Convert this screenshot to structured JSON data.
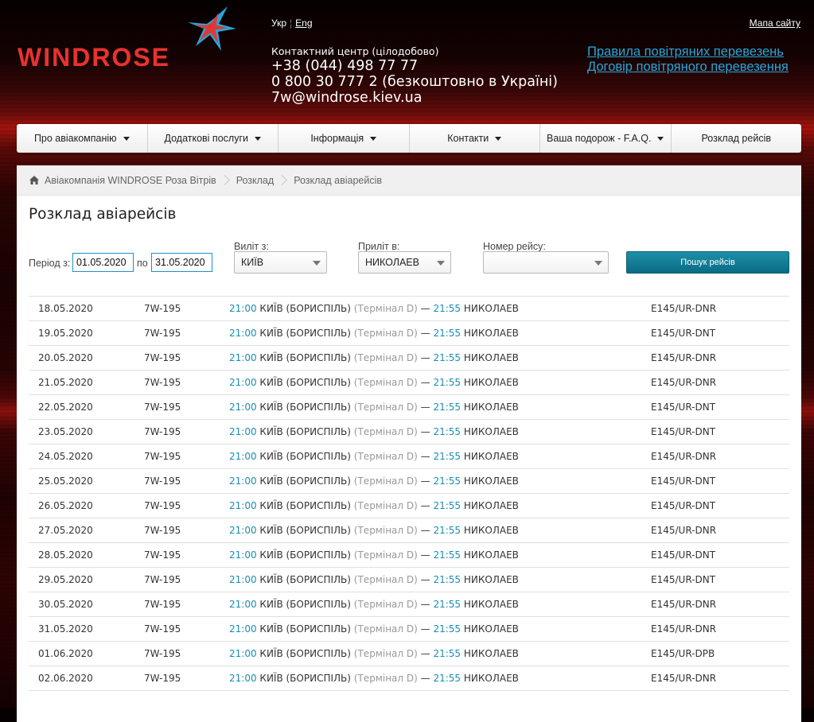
{
  "header": {
    "logo_text": "WINDROSE",
    "lang_ukr": "Укр",
    "lang_eng": "Eng",
    "sitemap": "Мапа сайту",
    "contact_label": "Контактний центр (цілодобово)",
    "phone1": "+38 (044) 498 77 77",
    "phone2": "0 800 30 777 2 (безкоштовно в Україні)",
    "email": "7w@windrose.kiev.ua",
    "link_rules": "Правила повітряних перевезень",
    "link_contract": "Договір повітряного перевезення",
    "logo_colors": {
      "red": "#e8322f",
      "blue": "#27a6d8"
    }
  },
  "nav": [
    {
      "label": "Про авіакомпанію",
      "has_caret": true
    },
    {
      "label": "Додаткові послуги",
      "has_caret": true
    },
    {
      "label": "Інформація",
      "has_caret": true
    },
    {
      "label": "Контакти",
      "has_caret": true
    },
    {
      "label": "Ваша подорож - F.A.Q.",
      "has_caret": true
    },
    {
      "label": "Розклад рейсів",
      "has_caret": false
    }
  ],
  "breadcrumb": [
    "Авіакомпанія WINDROSE Роза Вітрів",
    "Розклад",
    "Розклад авіарейсів"
  ],
  "page_title": "Розклад авіарейсів",
  "filters": {
    "period_label": "Період з:",
    "date_from": "01.05.2020",
    "to_label": "по",
    "date_to": "31.05.2020",
    "departure_label": "Виліт з:",
    "departure_value": "КИЇВ",
    "arrival_label": "Приліт в:",
    "arrival_value": "НИКОЛАЕВ",
    "flight_label": "Номер рейсу:",
    "flight_value": "",
    "search_button": "Пошук рейсів"
  },
  "schedule": [
    {
      "date": "18.05.2020",
      "flight": "7W-195",
      "dep_time": "21:00",
      "from": "КИЇВ (БОРИСПІЛЬ)",
      "terminal": "(Термінал D)",
      "dash": "—",
      "arr_time": "21:55",
      "to": "НИКОЛАЕВ",
      "aircraft": "E145/UR-DNR"
    },
    {
      "date": "19.05.2020",
      "flight": "7W-195",
      "dep_time": "21:00",
      "from": "КИЇВ (БОРИСПІЛЬ)",
      "terminal": "(Термінал D)",
      "dash": "—",
      "arr_time": "21:55",
      "to": "НИКОЛАЕВ",
      "aircraft": "E145/UR-DNT"
    },
    {
      "date": "20.05.2020",
      "flight": "7W-195",
      "dep_time": "21:00",
      "from": "КИЇВ (БОРИСПІЛЬ)",
      "terminal": "(Термінал D)",
      "dash": "—",
      "arr_time": "21:55",
      "to": "НИКОЛАЕВ",
      "aircraft": "E145/UR-DNR"
    },
    {
      "date": "21.05.2020",
      "flight": "7W-195",
      "dep_time": "21:00",
      "from": "КИЇВ (БОРИСПІЛЬ)",
      "terminal": "(Термінал D)",
      "dash": "—",
      "arr_time": "21:55",
      "to": "НИКОЛАЕВ",
      "aircraft": "E145/UR-DNR"
    },
    {
      "date": "22.05.2020",
      "flight": "7W-195",
      "dep_time": "21:00",
      "from": "КИЇВ (БОРИСПІЛЬ)",
      "terminal": "(Термінал D)",
      "dash": "—",
      "arr_time": "21:55",
      "to": "НИКОЛАЕВ",
      "aircraft": "E145/UR-DNT"
    },
    {
      "date": "23.05.2020",
      "flight": "7W-195",
      "dep_time": "21:00",
      "from": "КИЇВ (БОРИСПІЛЬ)",
      "terminal": "(Термінал D)",
      "dash": "—",
      "arr_time": "21:55",
      "to": "НИКОЛАЕВ",
      "aircraft": "E145/UR-DNT"
    },
    {
      "date": "24.05.2020",
      "flight": "7W-195",
      "dep_time": "21:00",
      "from": "КИЇВ (БОРИСПІЛЬ)",
      "terminal": "(Термінал D)",
      "dash": "—",
      "arr_time": "21:55",
      "to": "НИКОЛАЕВ",
      "aircraft": "E145/UR-DNR"
    },
    {
      "date": "25.05.2020",
      "flight": "7W-195",
      "dep_time": "21:00",
      "from": "КИЇВ (БОРИСПІЛЬ)",
      "terminal": "(Термінал D)",
      "dash": "—",
      "arr_time": "21:55",
      "to": "НИКОЛАЕВ",
      "aircraft": "E145/UR-DNT"
    },
    {
      "date": "26.05.2020",
      "flight": "7W-195",
      "dep_time": "21:00",
      "from": "КИЇВ (БОРИСПІЛЬ)",
      "terminal": "(Термінал D)",
      "dash": "—",
      "arr_time": "21:55",
      "to": "НИКОЛАЕВ",
      "aircraft": "E145/UR-DNT"
    },
    {
      "date": "27.05.2020",
      "flight": "7W-195",
      "dep_time": "21:00",
      "from": "КИЇВ (БОРИСПІЛЬ)",
      "terminal": "(Термінал D)",
      "dash": "—",
      "arr_time": "21:55",
      "to": "НИКОЛАЕВ",
      "aircraft": "E145/UR-DNR"
    },
    {
      "date": "28.05.2020",
      "flight": "7W-195",
      "dep_time": "21:00",
      "from": "КИЇВ (БОРИСПІЛЬ)",
      "terminal": "(Термінал D)",
      "dash": "—",
      "arr_time": "21:55",
      "to": "НИКОЛАЕВ",
      "aircraft": "E145/UR-DNT"
    },
    {
      "date": "29.05.2020",
      "flight": "7W-195",
      "dep_time": "21:00",
      "from": "КИЇВ (БОРИСПІЛЬ)",
      "terminal": "(Термінал D)",
      "dash": "—",
      "arr_time": "21:55",
      "to": "НИКОЛАЕВ",
      "aircraft": "E145/UR-DNT"
    },
    {
      "date": "30.05.2020",
      "flight": "7W-195",
      "dep_time": "21:00",
      "from": "КИЇВ (БОРИСПІЛЬ)",
      "terminal": "(Термінал D)",
      "dash": "—",
      "arr_time": "21:55",
      "to": "НИКОЛАЕВ",
      "aircraft": "E145/UR-DNR"
    },
    {
      "date": "31.05.2020",
      "flight": "7W-195",
      "dep_time": "21:00",
      "from": "КИЇВ (БОРИСПІЛЬ)",
      "terminal": "(Термінал D)",
      "dash": "—",
      "arr_time": "21:55",
      "to": "НИКОЛАЕВ",
      "aircraft": "E145/UR-DNR"
    },
    {
      "date": "01.06.2020",
      "flight": "7W-195",
      "dep_time": "21:00",
      "from": "КИЇВ (БОРИСПІЛЬ)",
      "terminal": "(Термінал D)",
      "dash": "—",
      "arr_time": "21:55",
      "to": "НИКОЛАЕВ",
      "aircraft": "E145/UR-DPB"
    },
    {
      "date": "02.06.2020",
      "flight": "7W-195",
      "dep_time": "21:00",
      "from": "КИЇВ (БОРИСПІЛЬ)",
      "terminal": "(Термінал D)",
      "dash": "—",
      "arr_time": "21:55",
      "to": "НИКОЛАЕВ",
      "aircraft": "E145/UR-DNR"
    }
  ]
}
